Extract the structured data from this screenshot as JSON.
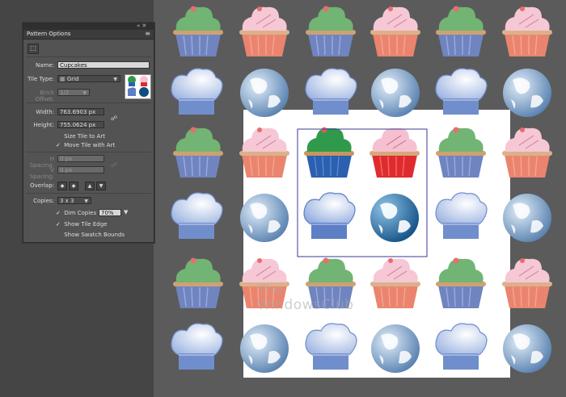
{
  "panel": {
    "title": "Pattern Options",
    "controls": "« ✕",
    "menu": "≡"
  },
  "form": {
    "tile_tool_icon": "tile-edit-icon",
    "name_label": "Name:",
    "name_value": "Cupcakes",
    "tile_type_label": "Tile Type:",
    "tile_type_value": "Grid",
    "brick_offset_label": "Brick Offset:",
    "brick_offset_value": "1/2",
    "width_label": "Width:",
    "width_value": "763.6903 px",
    "height_label": "Height:",
    "height_value": "755.0624 px",
    "size_tile_to_art": "Size Tile to Art",
    "move_tile_with_art": "Move Tile with Art",
    "h_spacing_label": "H Spacing:",
    "h_spacing_value": "0 px",
    "v_spacing_label": "V Spacing:",
    "v_spacing_value": "0 px",
    "overlap_label": "Overlap:",
    "copies_label": "Copies:",
    "copies_value": "3 x 3",
    "dim_copies_label": "Dim Copies to:",
    "dim_copies_value": "70%",
    "show_tile_edge": "Show Tile Edge",
    "show_swatch_bounds": "Show Swatch Bounds",
    "move_tile_checked": true,
    "dim_copies_checked": true,
    "show_tile_edge_checked": true
  },
  "watermark": {
    "line1": "The",
    "line2": "WindowsClub"
  },
  "colors": {
    "background": "#454545",
    "artboard": "#ffffff",
    "tile_border": "#3a3a9a",
    "cupcake_green": "#5faa60",
    "cupcake_pink": "#f5c0cf",
    "wrapper_blue": "#5d74b8",
    "wrapper_orange": "#e9735a",
    "wrapper_red": "#e02b2e",
    "globe_blue": "#2f6ea8",
    "hat_blue": "#5d7fc5"
  }
}
